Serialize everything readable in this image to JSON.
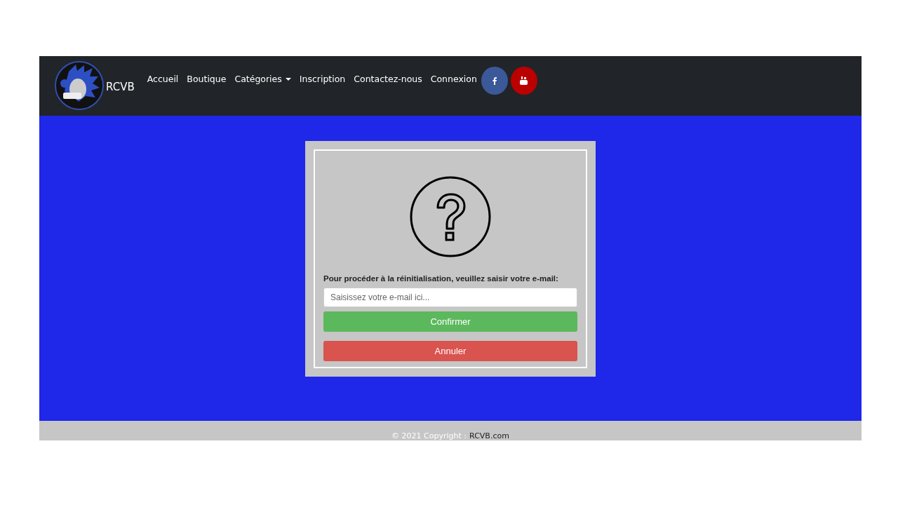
{
  "navbar": {
    "brand": "RCVB",
    "links": [
      {
        "label": "Accueil",
        "kind": "link"
      },
      {
        "label": "Boutique",
        "kind": "link"
      },
      {
        "label": "Catégories",
        "kind": "dropdown"
      },
      {
        "label": "Inscription",
        "kind": "link"
      },
      {
        "label": "Contactez-nous",
        "kind": "link"
      },
      {
        "label": "Connexion",
        "kind": "link"
      }
    ],
    "social": [
      {
        "kind": "facebook",
        "color": "#3b5998"
      },
      {
        "kind": "youtube",
        "color": "#bb0000"
      }
    ]
  },
  "reset_form": {
    "prompt": "Pour procéder à la réinitialisation, veuillez saisir votre e-mail:",
    "email_placeholder": "Saisissez votre e-mail ici...",
    "buttons": [
      {
        "label": "Confirmer",
        "kind": "confirm"
      },
      {
        "label": "Annuler",
        "kind": "cancel"
      }
    ]
  },
  "footer": {
    "copyright": "© 2021 Copyright :",
    "link": "RCVB.com"
  }
}
